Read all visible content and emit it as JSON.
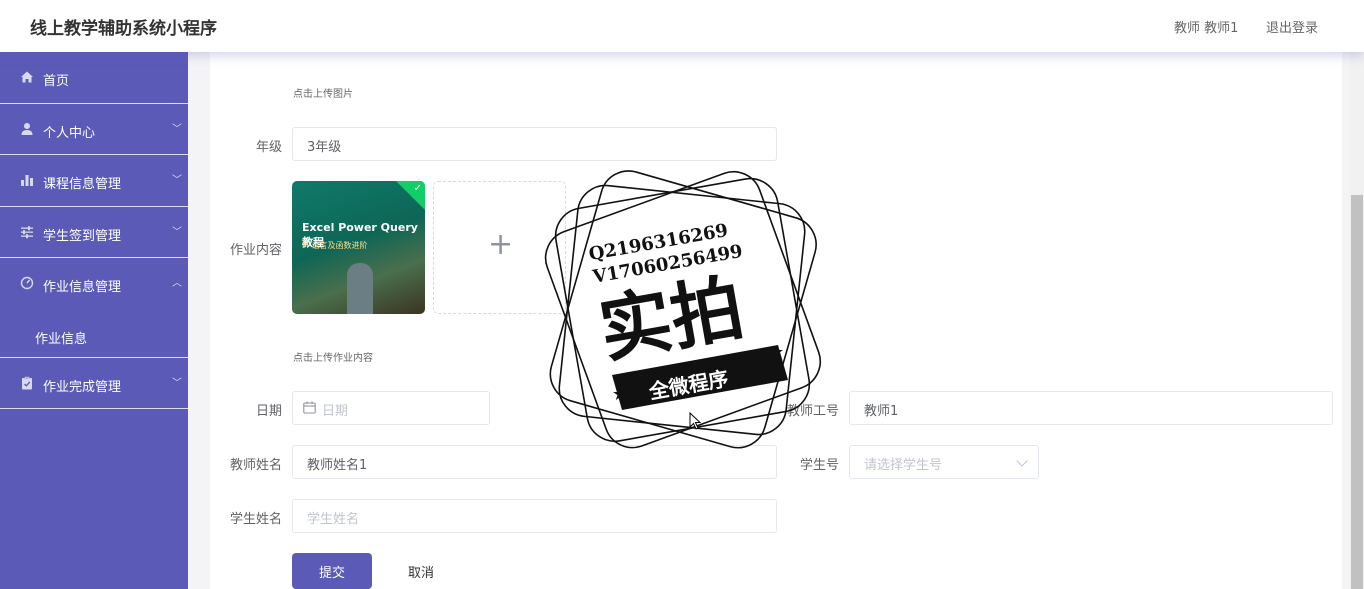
{
  "app": {
    "title": "线上教学辅助系统小程序"
  },
  "header": {
    "user": "教师 教师1",
    "logout": "退出登录"
  },
  "sidebar": {
    "items": [
      {
        "label": "首页",
        "icon": "home-icon"
      },
      {
        "label": "个人中心",
        "icon": "user-icon"
      },
      {
        "label": "课程信息管理",
        "icon": "bar-chart-icon"
      },
      {
        "label": "学生签到管理",
        "icon": "sliders-icon"
      },
      {
        "label": "作业信息管理",
        "icon": "dashboard-icon"
      },
      {
        "label": "作业完成管理",
        "icon": "clipboard-icon"
      }
    ],
    "sub_item": "作业信息"
  },
  "form": {
    "upload_image_hint": "点击上传图片",
    "grade": {
      "label": "年级",
      "value": "3年级"
    },
    "content": {
      "label": "作业内容",
      "thumb_title": "Excel Power Query 教程",
      "thumb_subtitle": "M 语言及函数进阶",
      "hint": "点击上传作业内容"
    },
    "date": {
      "label": "日期",
      "placeholder": "日期"
    },
    "teacher_id": {
      "label": "教师工号",
      "value": "教师1"
    },
    "teacher_name": {
      "label": "教师姓名",
      "value": "教师姓名1"
    },
    "student_id": {
      "label": "学生号",
      "placeholder": "请选择学生号"
    },
    "student_name": {
      "label": "学生姓名",
      "placeholder": "学生姓名"
    },
    "submit": "提交",
    "cancel": "取消"
  },
  "watermark": {
    "line1": "Q2196316269",
    "line2": "V17060256499",
    "main": "实拍",
    "ribbon": "全微程序"
  },
  "colors": {
    "accent": "#5b5bb7",
    "success": "#13ce66"
  }
}
